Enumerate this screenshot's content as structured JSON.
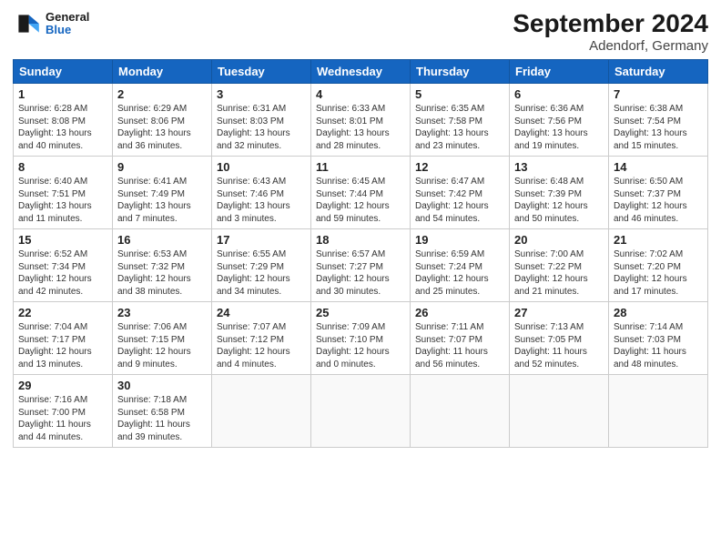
{
  "header": {
    "logo_line1": "General",
    "logo_line2": "Blue",
    "month": "September 2024",
    "location": "Adendorf, Germany"
  },
  "days_of_week": [
    "Sunday",
    "Monday",
    "Tuesday",
    "Wednesday",
    "Thursday",
    "Friday",
    "Saturday"
  ],
  "weeks": [
    [
      {
        "day": 1,
        "info": "Sunrise: 6:28 AM\nSunset: 8:08 PM\nDaylight: 13 hours\nand 40 minutes."
      },
      {
        "day": 2,
        "info": "Sunrise: 6:29 AM\nSunset: 8:06 PM\nDaylight: 13 hours\nand 36 minutes."
      },
      {
        "day": 3,
        "info": "Sunrise: 6:31 AM\nSunset: 8:03 PM\nDaylight: 13 hours\nand 32 minutes."
      },
      {
        "day": 4,
        "info": "Sunrise: 6:33 AM\nSunset: 8:01 PM\nDaylight: 13 hours\nand 28 minutes."
      },
      {
        "day": 5,
        "info": "Sunrise: 6:35 AM\nSunset: 7:58 PM\nDaylight: 13 hours\nand 23 minutes."
      },
      {
        "day": 6,
        "info": "Sunrise: 6:36 AM\nSunset: 7:56 PM\nDaylight: 13 hours\nand 19 minutes."
      },
      {
        "day": 7,
        "info": "Sunrise: 6:38 AM\nSunset: 7:54 PM\nDaylight: 13 hours\nand 15 minutes."
      }
    ],
    [
      {
        "day": 8,
        "info": "Sunrise: 6:40 AM\nSunset: 7:51 PM\nDaylight: 13 hours\nand 11 minutes."
      },
      {
        "day": 9,
        "info": "Sunrise: 6:41 AM\nSunset: 7:49 PM\nDaylight: 13 hours\nand 7 minutes."
      },
      {
        "day": 10,
        "info": "Sunrise: 6:43 AM\nSunset: 7:46 PM\nDaylight: 13 hours\nand 3 minutes."
      },
      {
        "day": 11,
        "info": "Sunrise: 6:45 AM\nSunset: 7:44 PM\nDaylight: 12 hours\nand 59 minutes."
      },
      {
        "day": 12,
        "info": "Sunrise: 6:47 AM\nSunset: 7:42 PM\nDaylight: 12 hours\nand 54 minutes."
      },
      {
        "day": 13,
        "info": "Sunrise: 6:48 AM\nSunset: 7:39 PM\nDaylight: 12 hours\nand 50 minutes."
      },
      {
        "day": 14,
        "info": "Sunrise: 6:50 AM\nSunset: 7:37 PM\nDaylight: 12 hours\nand 46 minutes."
      }
    ],
    [
      {
        "day": 15,
        "info": "Sunrise: 6:52 AM\nSunset: 7:34 PM\nDaylight: 12 hours\nand 42 minutes."
      },
      {
        "day": 16,
        "info": "Sunrise: 6:53 AM\nSunset: 7:32 PM\nDaylight: 12 hours\nand 38 minutes."
      },
      {
        "day": 17,
        "info": "Sunrise: 6:55 AM\nSunset: 7:29 PM\nDaylight: 12 hours\nand 34 minutes."
      },
      {
        "day": 18,
        "info": "Sunrise: 6:57 AM\nSunset: 7:27 PM\nDaylight: 12 hours\nand 30 minutes."
      },
      {
        "day": 19,
        "info": "Sunrise: 6:59 AM\nSunset: 7:24 PM\nDaylight: 12 hours\nand 25 minutes."
      },
      {
        "day": 20,
        "info": "Sunrise: 7:00 AM\nSunset: 7:22 PM\nDaylight: 12 hours\nand 21 minutes."
      },
      {
        "day": 21,
        "info": "Sunrise: 7:02 AM\nSunset: 7:20 PM\nDaylight: 12 hours\nand 17 minutes."
      }
    ],
    [
      {
        "day": 22,
        "info": "Sunrise: 7:04 AM\nSunset: 7:17 PM\nDaylight: 12 hours\nand 13 minutes."
      },
      {
        "day": 23,
        "info": "Sunrise: 7:06 AM\nSunset: 7:15 PM\nDaylight: 12 hours\nand 9 minutes."
      },
      {
        "day": 24,
        "info": "Sunrise: 7:07 AM\nSunset: 7:12 PM\nDaylight: 12 hours\nand 4 minutes."
      },
      {
        "day": 25,
        "info": "Sunrise: 7:09 AM\nSunset: 7:10 PM\nDaylight: 12 hours\nand 0 minutes."
      },
      {
        "day": 26,
        "info": "Sunrise: 7:11 AM\nSunset: 7:07 PM\nDaylight: 11 hours\nand 56 minutes."
      },
      {
        "day": 27,
        "info": "Sunrise: 7:13 AM\nSunset: 7:05 PM\nDaylight: 11 hours\nand 52 minutes."
      },
      {
        "day": 28,
        "info": "Sunrise: 7:14 AM\nSunset: 7:03 PM\nDaylight: 11 hours\nand 48 minutes."
      }
    ],
    [
      {
        "day": 29,
        "info": "Sunrise: 7:16 AM\nSunset: 7:00 PM\nDaylight: 11 hours\nand 44 minutes."
      },
      {
        "day": 30,
        "info": "Sunrise: 7:18 AM\nSunset: 6:58 PM\nDaylight: 11 hours\nand 39 minutes."
      },
      null,
      null,
      null,
      null,
      null
    ]
  ]
}
